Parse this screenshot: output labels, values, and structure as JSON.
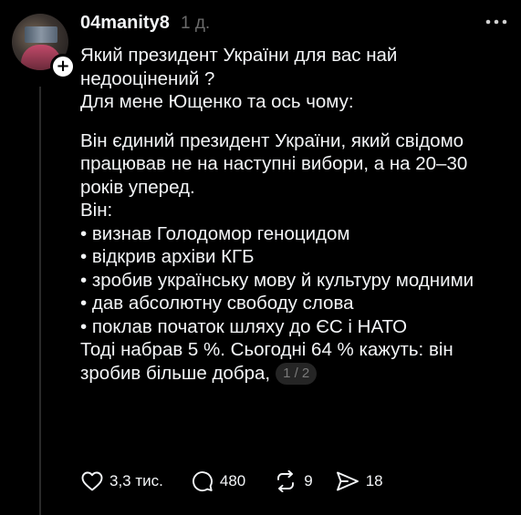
{
  "post": {
    "username": "04manity8",
    "timestamp": "1 д.",
    "lines_intro": [
      "Який президент України для вас най",
      "недооцінений ?",
      "Для мене Ющенко та ось чому:"
    ],
    "lines_body": [
      "Він єдиний президент України, який свідомо",
      "працював не на наступні вибори, а на 20–30",
      "років уперед.",
      "Він:"
    ],
    "bullets": [
      "• визнав Голодомор геноцидом",
      "• відкрив архіви КГБ",
      "• зробив українську мову й культуру модними",
      "• дав абсолютну свободу слова",
      "• поклав початок шляху до ЄС і НАТО"
    ],
    "lines_end": [
      "Тоді набрав 5 %. Сьогодні 64 % кажуть: він"
    ],
    "last_line": "зробив більше добра,",
    "page_indicator": "1 / 2"
  },
  "actions": {
    "likes": "3,3 тис.",
    "comments": "480",
    "reposts": "9",
    "shares": "18"
  },
  "icons": {
    "follow": "plus-icon",
    "more": "more-dots-icon",
    "like": "heart-icon",
    "comment": "comment-bubble-icon",
    "repost": "repost-icon",
    "share": "send-icon"
  },
  "colors": {
    "background": "#000000",
    "text": "#f3f5f7",
    "muted": "#6b6b6b"
  }
}
